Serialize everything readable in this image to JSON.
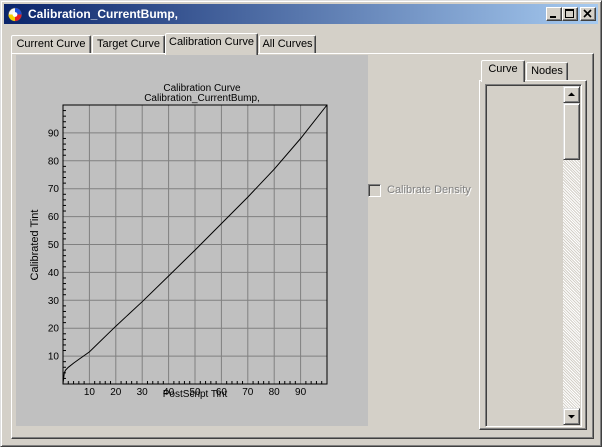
{
  "window": {
    "title": "Calibration_CurrentBump,"
  },
  "tabs": [
    {
      "label": "Current Curve",
      "active": false
    },
    {
      "label": "Target Curve",
      "active": false
    },
    {
      "label": "Calibration Curve",
      "active": true
    },
    {
      "label": "All Curves",
      "active": false
    }
  ],
  "checkbox": {
    "label": "Calibrate Density",
    "checked": false,
    "enabled": false
  },
  "side_tabs": [
    {
      "label": "Curve",
      "active": true
    },
    {
      "label": "Nodes",
      "active": false
    }
  ],
  "icons": {
    "app": "app-logo-icon",
    "minimize": "minimize-icon",
    "maximize": "maximize-icon",
    "close": "close-icon",
    "scroll_up": "arrow-up-icon",
    "scroll_down": "arrow-down-icon"
  },
  "colors": {
    "titlebar_start": "#0a246a",
    "titlebar_end": "#a6caf0",
    "face": "#d4d0c8",
    "chart_bg": "#c0c0c0"
  },
  "chart_data": {
    "type": "line",
    "title": "Calibration Curve",
    "subtitle": "Calibration_CurrentBump,",
    "xlabel": "PostScript Tint",
    "ylabel": "Calibrated Tint",
    "xlim": [
      0,
      100
    ],
    "ylim": [
      0,
      100
    ],
    "x_ticks": [
      10,
      20,
      30,
      40,
      50,
      60,
      70,
      80,
      90
    ],
    "y_ticks": [
      10,
      20,
      30,
      40,
      50,
      60,
      70,
      80,
      90
    ],
    "grid": true,
    "legend": "none",
    "series": [
      {
        "x": [
          0,
          0.5,
          1,
          2,
          4,
          6,
          10,
          20,
          30,
          40,
          50,
          60,
          70,
          80,
          90,
          100
        ],
        "y": [
          0,
          4,
          5,
          6,
          7.5,
          8.8,
          11.5,
          20.7,
          29.5,
          38.7,
          48,
          57.5,
          67,
          77,
          88,
          100
        ]
      }
    ]
  }
}
